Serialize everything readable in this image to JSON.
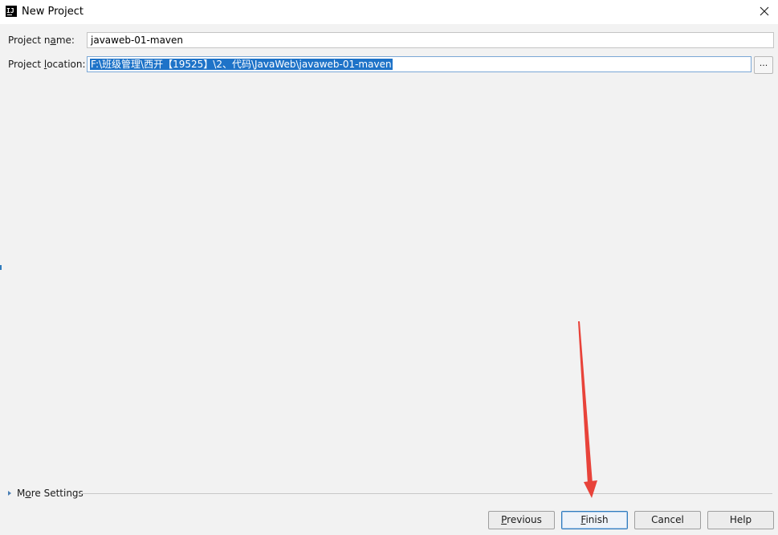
{
  "window": {
    "title": "New Project",
    "app_icon_text": "IJ"
  },
  "form": {
    "project_name": {
      "label_pre": "Project n",
      "label_mnemonic": "a",
      "label_post": "me:",
      "value": "javaweb-01-maven"
    },
    "project_location": {
      "label_pre": "Project ",
      "label_mnemonic": "l",
      "label_post": "ocation:",
      "value": "F:\\班级管理\\西开【19525】\\2、代码\\JavaWeb\\javaweb-01-maven",
      "browse_label": "..."
    }
  },
  "more_settings": {
    "label_pre": "M",
    "label_mnemonic": "o",
    "label_post": "re Settings"
  },
  "buttons": {
    "previous": {
      "mnemonic": "P",
      "rest": "revious"
    },
    "finish": {
      "mnemonic": "F",
      "rest": "inish"
    },
    "cancel": "Cancel",
    "help": "Help"
  },
  "annotation": {
    "arrow_color": "#e8433a"
  },
  "colors": {
    "accent": "#2f7bbd",
    "selection": "#1e73c8"
  }
}
